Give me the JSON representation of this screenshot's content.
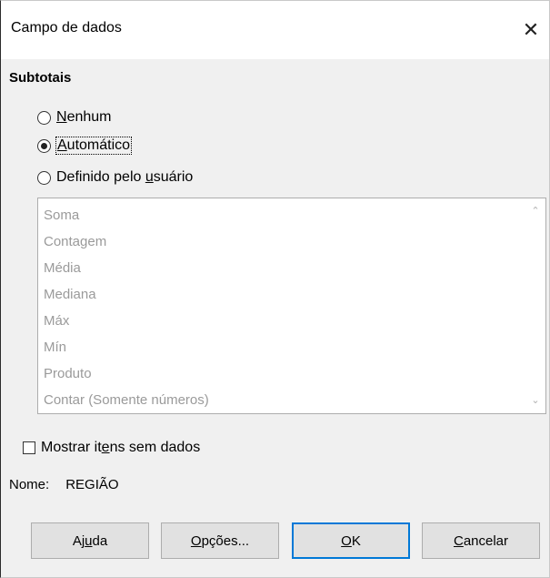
{
  "window": {
    "title": "Campo de dados",
    "close_glyph": "✕"
  },
  "subtotals": {
    "heading": "Subtotais",
    "options": [
      {
        "pre": "",
        "ul": "N",
        "post": "enhum",
        "checked": false
      },
      {
        "pre": "",
        "ul": "A",
        "post": "utomático",
        "checked": true
      },
      {
        "pre": "Definido pelo ",
        "ul": "u",
        "post": "suário",
        "checked": false
      }
    ],
    "functions": [
      "Soma",
      "Contagem",
      "Média",
      "Mediana",
      "Máx",
      "Mín",
      "Produto",
      "Contar (Somente números)"
    ]
  },
  "show_items": {
    "pre": "Mostrar it",
    "ul": "e",
    "post": "ns sem dados",
    "checked": false
  },
  "name": {
    "label": "Nome:",
    "value": "REGIÃO"
  },
  "buttons": {
    "help": {
      "pre": "Aj",
      "ul": "u",
      "post": "da"
    },
    "options": {
      "pre": "",
      "ul": "O",
      "post": "pções..."
    },
    "ok": {
      "pre": "",
      "ul": "O",
      "post": "K"
    },
    "cancel": {
      "pre": "",
      "ul": "C",
      "post": "ancelar"
    }
  },
  "icons": {
    "scroll_up": "⌃",
    "scroll_down": "⌄"
  }
}
